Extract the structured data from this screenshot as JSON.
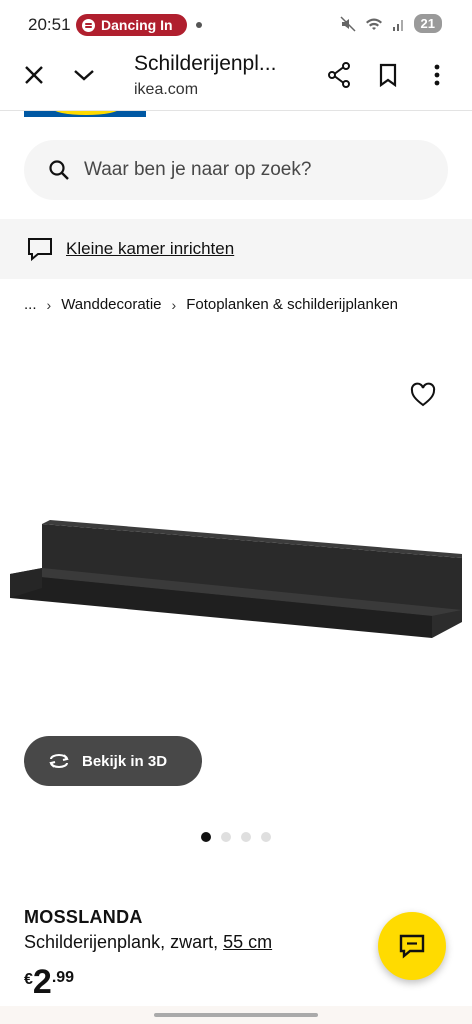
{
  "status_bar": {
    "time": "20:51",
    "media_label": "Dancing In",
    "battery": "21"
  },
  "browser": {
    "title": "Schilderijenpl...",
    "url": "ikea.com"
  },
  "search": {
    "placeholder": "Waar ben je naar op zoek?"
  },
  "banner": {
    "link_text": "Kleine kamer inrichten"
  },
  "breadcrumb": {
    "items": [
      "...",
      "Wanddecoratie",
      "Fotoplanken & schilderijplanken"
    ]
  },
  "product": {
    "name": "MOSSLANDA",
    "description": "Schilderijenplank, zwart, ",
    "measurement": "55 cm",
    "price_currency": "€",
    "price_integer": "2",
    "price_decimal": ".99",
    "view_3d_label": "Bekijk in 3D",
    "image_count": 4,
    "active_image": 1
  },
  "colors": {
    "ikea_blue": "#0058a3",
    "ikea_yellow": "#ffdb00",
    "media_red": "#b01f2e",
    "button_dark": "#484848"
  },
  "icons": [
    "close-icon",
    "chevron-down-icon",
    "share-icon",
    "bookmark-icon",
    "more-icon",
    "search-icon",
    "chat-icon",
    "heart-icon",
    "rotate-3d-icon"
  ]
}
